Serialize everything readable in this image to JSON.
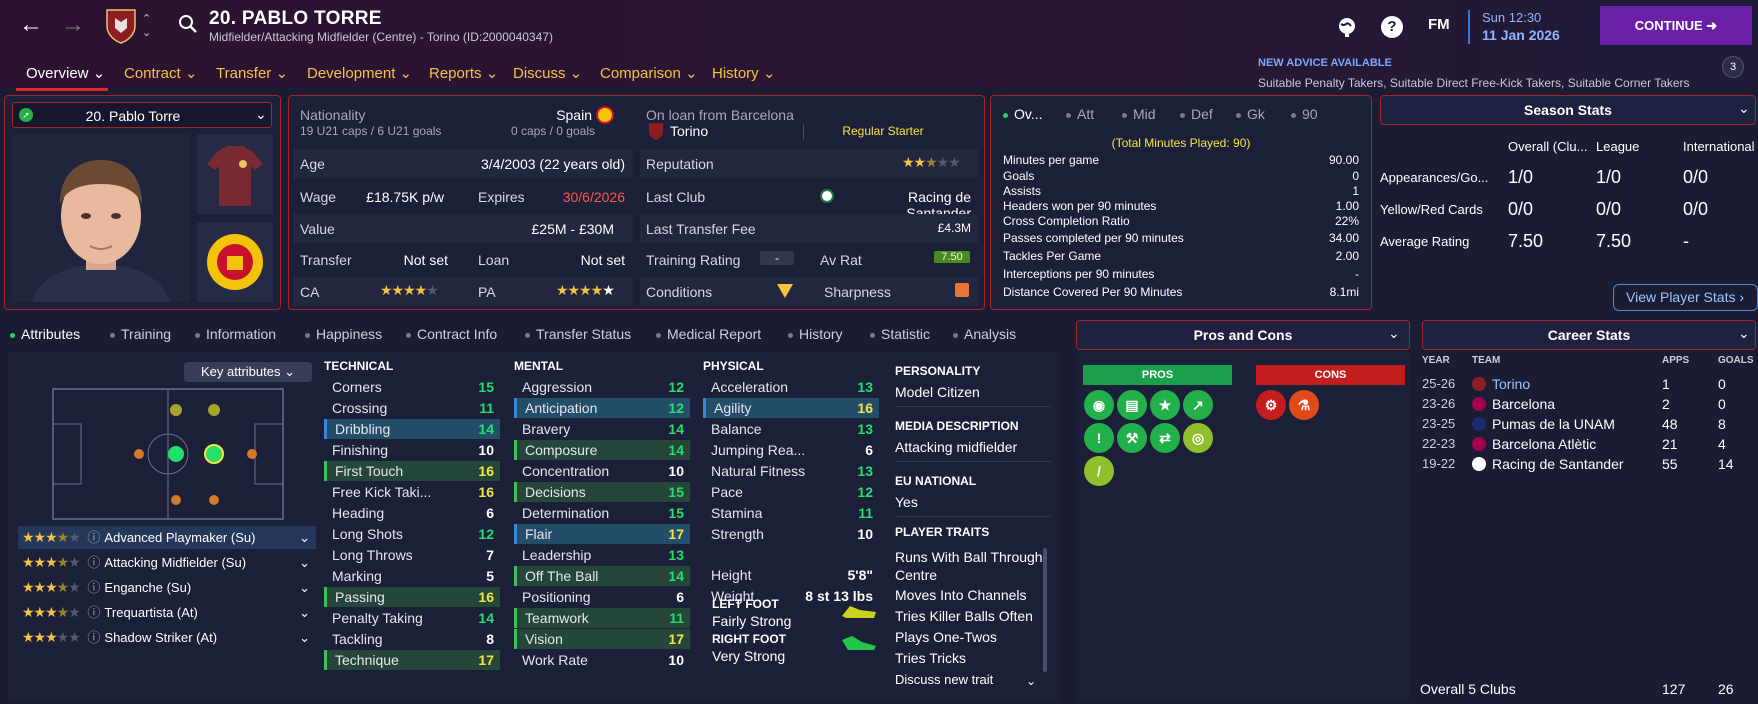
{
  "header": {
    "title": "20. PABLO TORRE",
    "subtitle": "Midfielder/Attacking Midfielder (Centre) - Torino (ID:2000040347)",
    "time": "Sun 12:30",
    "date": "11 Jan 2026",
    "continue_label": "CONTINUE",
    "fm_label": "FM",
    "help_label": "?",
    "advice_title": "NEW ADVICE AVAILABLE",
    "advice_text": "Suitable Penalty Takers, Suitable Direct Free-Kick Takers, Suitable Corner Takers",
    "advice_count": "3"
  },
  "nav_tabs": [
    {
      "label": "Overview"
    },
    {
      "label": "Contract"
    },
    {
      "label": "Transfer"
    },
    {
      "label": "Development"
    },
    {
      "label": "Reports"
    },
    {
      "label": "Discuss"
    },
    {
      "label": "Comparison"
    },
    {
      "label": "History"
    }
  ],
  "player_selector": "20. Pablo Torre",
  "info": {
    "nationality_label": "Nationality",
    "nationality": "Spain",
    "caps": "19 U21 caps / 6 U21 goals",
    "senior_caps": "0 caps / 0 goals",
    "loan_label": "On loan from Barcelona",
    "loan_club": "Torino",
    "squad_status": "Regular Starter",
    "age_label": "Age",
    "age": "3/4/2003 (22 years old)",
    "reputation_label": "Reputation",
    "reputation_stars": 2.5,
    "wage_label": "Wage",
    "wage": "£18.75K p/w",
    "expires_label": "Expires",
    "expires": "30/6/2026",
    "last_club_label": "Last Club",
    "last_club": "Racing de Santander",
    "value_label": "Value",
    "value": "£25M - £30M",
    "last_fee_label": "Last Transfer Fee",
    "last_fee": "£4.3M",
    "transfer_label": "Transfer",
    "transfer": "Not set",
    "loan_status_label": "Loan",
    "loan_status": "Not set",
    "training_label": "Training Rating",
    "training": "-",
    "avrat_label": "Av Rat",
    "avrat": "7.50",
    "ca_label": "CA",
    "ca_stars": 4,
    "pa_label": "PA",
    "pa_stars": 5,
    "conditions_label": "Conditions",
    "sharpness_label": "Sharpness"
  },
  "overview_stats": {
    "tabs": [
      "Ov...",
      "Att",
      "Mid",
      "Def",
      "Gk",
      "90"
    ],
    "total_minutes": "(Total Minutes Played: 90)",
    "rows": [
      {
        "label": "Minutes per game",
        "value": "90.00"
      },
      {
        "label": "Goals",
        "value": "0"
      },
      {
        "label": "Assists",
        "value": "1"
      },
      {
        "label": "Headers won per 90 minutes",
        "value": "1.00"
      },
      {
        "label": "Cross Completion Ratio",
        "value": "22%"
      },
      {
        "label": "Passes completed per 90 minutes",
        "value": "34.00"
      },
      {
        "label": "Tackles Per Game",
        "value": "2.00"
      },
      {
        "label": "Interceptions per 90 minutes",
        "value": "-"
      },
      {
        "label": "Distance Covered Per 90 Minutes",
        "value": "8.1mi"
      }
    ]
  },
  "season_stats": {
    "title": "Season Stats",
    "cols": [
      "Overall (Clu...",
      "League",
      "International"
    ],
    "rows": [
      {
        "label": "Appearances/Go...",
        "values": [
          "1/0",
          "1/0",
          "0/0"
        ]
      },
      {
        "label": "Yellow/Red Cards",
        "values": [
          "0/0",
          "0/0",
          "0/0"
        ]
      },
      {
        "label": "Average Rating",
        "values": [
          "7.50",
          "7.50",
          "-"
        ]
      }
    ],
    "button": "View Player Stats"
  },
  "sub_tabs": [
    "Attributes",
    "Training",
    "Information",
    "Happiness",
    "Contract Info",
    "Transfer Status",
    "Medical Report",
    "History",
    "Statistic",
    "Analysis"
  ],
  "key_attributes_label": "Key attributes",
  "roles": [
    {
      "stars": 3.5,
      "name": "Advanced Playmaker (Su)"
    },
    {
      "stars": 3.5,
      "name": "Attacking Midfielder (Su)"
    },
    {
      "stars": 3.5,
      "name": "Enganche (Su)"
    },
    {
      "stars": 3.5,
      "name": "Trequartista (At)"
    },
    {
      "stars": 3,
      "name": "Shadow Striker (At)"
    }
  ],
  "technical": {
    "title": "TECHNICAL",
    "rows": [
      {
        "n": "Corners",
        "v": "15"
      },
      {
        "n": "Crossing",
        "v": "11"
      },
      {
        "n": "Dribbling",
        "v": "14"
      },
      {
        "n": "Finishing",
        "v": "10"
      },
      {
        "n": "First Touch",
        "v": "16"
      },
      {
        "n": "Free Kick Taki...",
        "v": "16"
      },
      {
        "n": "Heading",
        "v": "6"
      },
      {
        "n": "Long Shots",
        "v": "12"
      },
      {
        "n": "Long Throws",
        "v": "7"
      },
      {
        "n": "Marking",
        "v": "5"
      },
      {
        "n": "Passing",
        "v": "16"
      },
      {
        "n": "Penalty Taking",
        "v": "14"
      },
      {
        "n": "Tackling",
        "v": "8"
      },
      {
        "n": "Technique",
        "v": "17"
      }
    ]
  },
  "mental": {
    "title": "MENTAL",
    "rows": [
      {
        "n": "Aggression",
        "v": "12"
      },
      {
        "n": "Anticipation",
        "v": "12"
      },
      {
        "n": "Bravery",
        "v": "14"
      },
      {
        "n": "Composure",
        "v": "14"
      },
      {
        "n": "Concentration",
        "v": "10"
      },
      {
        "n": "Decisions",
        "v": "15"
      },
      {
        "n": "Determination",
        "v": "15"
      },
      {
        "n": "Flair",
        "v": "17"
      },
      {
        "n": "Leadership",
        "v": "13"
      },
      {
        "n": "Off The Ball",
        "v": "14"
      },
      {
        "n": "Positioning",
        "v": "6"
      },
      {
        "n": "Teamwork",
        "v": "11"
      },
      {
        "n": "Vision",
        "v": "17"
      },
      {
        "n": "Work Rate",
        "v": "10"
      }
    ]
  },
  "physical": {
    "title": "PHYSICAL",
    "rows": [
      {
        "n": "Acceleration",
        "v": "13"
      },
      {
        "n": "Agility",
        "v": "16"
      },
      {
        "n": "Balance",
        "v": "13"
      },
      {
        "n": "Jumping Rea...",
        "v": "6"
      },
      {
        "n": "Natural Fitness",
        "v": "13"
      },
      {
        "n": "Pace",
        "v": "12"
      },
      {
        "n": "Stamina",
        "v": "11"
      },
      {
        "n": "Strength",
        "v": "10"
      }
    ],
    "height_label": "Height",
    "height": "5'8\"",
    "weight_label": "Weight",
    "weight": "8 st 13 lbs",
    "left_foot_label": "LEFT FOOT",
    "left_foot": "Fairly Strong",
    "right_foot_label": "RIGHT FOOT",
    "right_foot": "Very Strong"
  },
  "personality": {
    "personality_label": "PERSONALITY",
    "personality": "Model Citizen",
    "media_label": "MEDIA DESCRIPTION",
    "media": "Attacking midfielder",
    "eu_label": "EU NATIONAL",
    "eu": "Yes",
    "traits_label": "PLAYER TRAITS",
    "traits": [
      "Runs With Ball Through Centre",
      "Moves Into Channels",
      "Tries Killer Balls Often",
      "Plays One-Twos",
      "Tries Tricks"
    ],
    "discuss": "Discuss new trait"
  },
  "pros_cons": {
    "title": "Pros and Cons",
    "pros_label": "PROS",
    "cons_label": "CONS"
  },
  "career": {
    "title": "Career Stats",
    "cols": [
      "YEAR",
      "TEAM",
      "APPS",
      "GOALS"
    ],
    "rows": [
      {
        "year": "25-26",
        "team": "Torino",
        "apps": "1",
        "goals": "0"
      },
      {
        "year": "23-26",
        "team": "Barcelona",
        "apps": "2",
        "goals": "0"
      },
      {
        "year": "23-25",
        "team": "Pumas de la UNAM",
        "apps": "48",
        "goals": "8"
      },
      {
        "year": "22-23",
        "team": "Barcelona Atlètic",
        "apps": "21",
        "goals": "4"
      },
      {
        "year": "19-22",
        "team": "Racing de Santander",
        "apps": "55",
        "goals": "14"
      }
    ],
    "total_label": "Overall 5 Clubs",
    "total_apps": "127",
    "total_goals": "26"
  },
  "colors": {
    "accent": "#a52429",
    "continue": "#6a1fa6",
    "green": "#22e06a",
    "yellow": "#f7e443",
    "gold": "#f3c341"
  }
}
